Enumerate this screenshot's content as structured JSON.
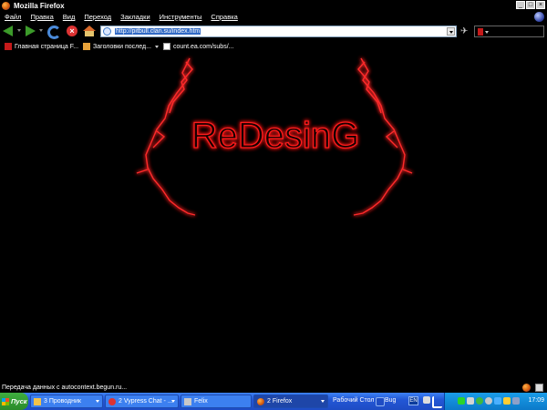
{
  "window": {
    "title": "Mozilla Firefox"
  },
  "menu": {
    "items": [
      {
        "label": "Файл"
      },
      {
        "label": "Правка"
      },
      {
        "label": "Вид"
      },
      {
        "label": "Переход"
      },
      {
        "label": "Закладки"
      },
      {
        "label": "Инструменты"
      },
      {
        "label": "Справка"
      }
    ]
  },
  "navigation": {
    "url": "http://pitbull.clan.su/index.htm"
  },
  "bookmarks": {
    "items": [
      {
        "label": "Главная страница F..."
      },
      {
        "label": "Заголовки послед..."
      },
      {
        "label": "count.ea.com/subs/..."
      }
    ]
  },
  "page": {
    "logo_text": "ReDesinG",
    "accent_color": "#ff1a1a"
  },
  "status": {
    "text": "Передача данных с autocontext.begun.ru..."
  },
  "taskbar": {
    "start_label": "Пуск",
    "tasks": [
      {
        "label": "3 Проводник"
      },
      {
        "label": "2 Vypress Chat - ..."
      },
      {
        "label": "Felix"
      },
      {
        "label": "2 Firefox"
      }
    ],
    "quick_labels": [
      "Рабочий Стол",
      "Bug"
    ],
    "language": "EN",
    "clock": "17:09"
  }
}
